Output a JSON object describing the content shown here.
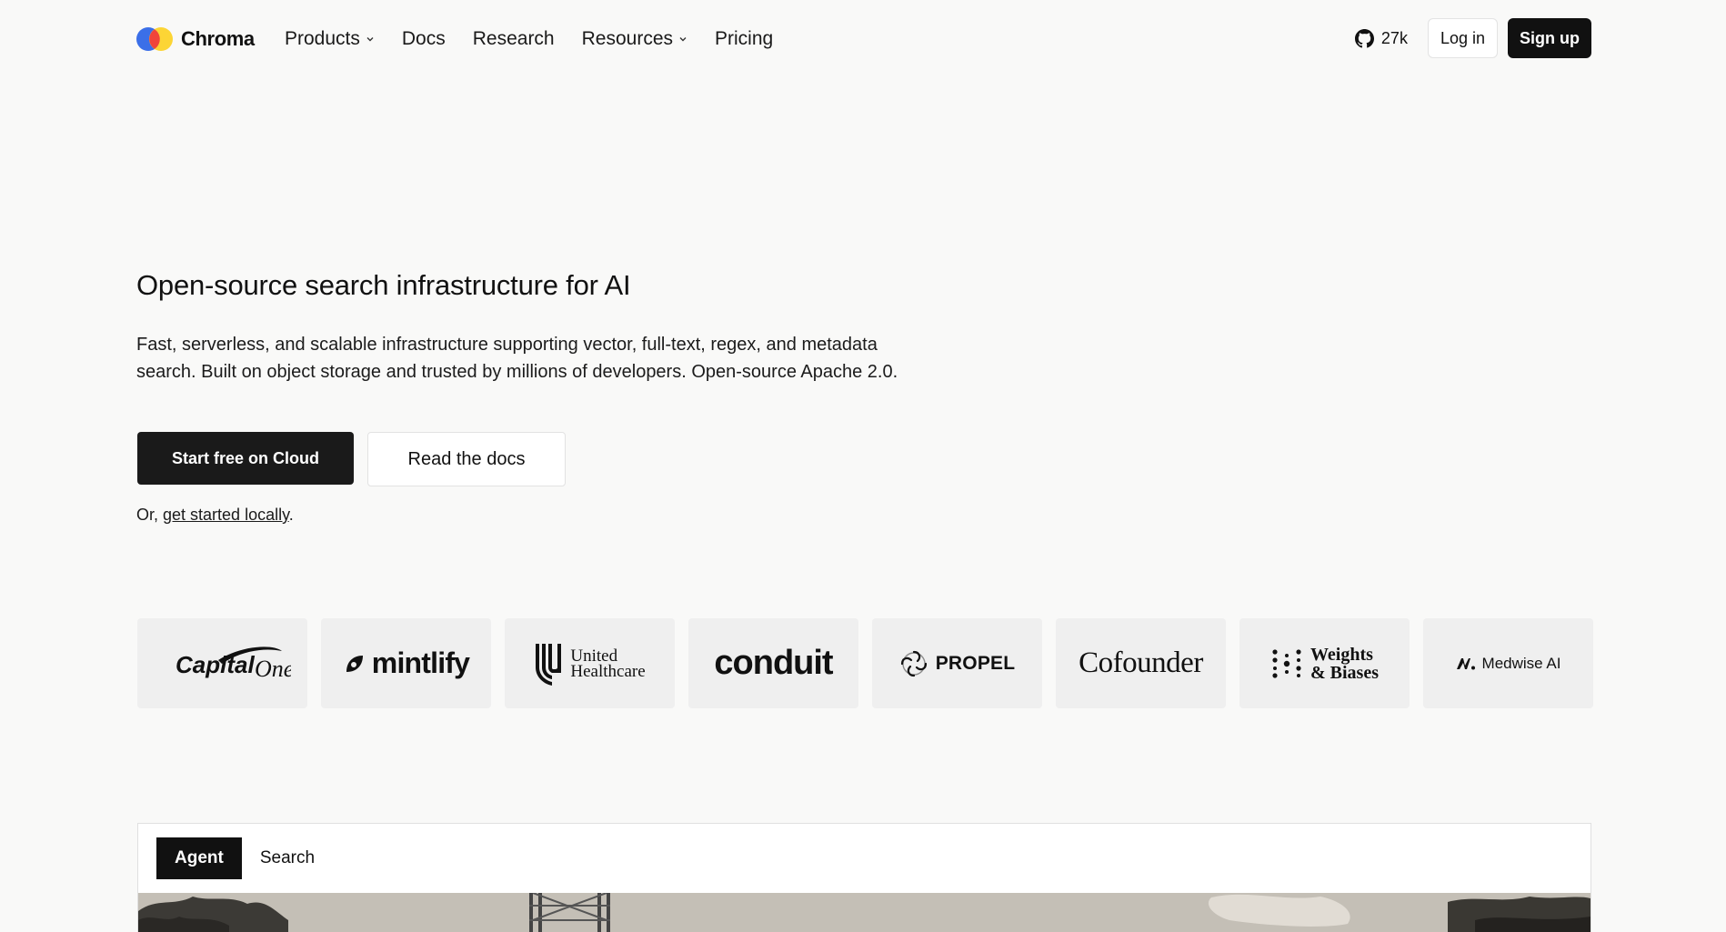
{
  "nav": {
    "brand": "Chroma",
    "links": [
      {
        "label": "Products",
        "dropdown": true
      },
      {
        "label": "Docs",
        "dropdown": false
      },
      {
        "label": "Research",
        "dropdown": false
      },
      {
        "label": "Resources",
        "dropdown": true
      },
      {
        "label": "Pricing",
        "dropdown": false
      }
    ],
    "github_stars": "27k",
    "login_label": "Log in",
    "signup_label": "Sign up"
  },
  "hero": {
    "title": "Open-source search infrastructure for AI",
    "subtitle_line1": "Fast, serverless, and scalable infrastructure supporting vector, full-text, regex, and metadata",
    "subtitle_line2": "search. Built on object storage and trusted by millions of developers. Open-source Apache 2.0.",
    "primary_cta": "Start free on Cloud",
    "secondary_cta": "Read the docs",
    "local_prefix": "Or, ",
    "local_link": "get started locally",
    "local_suffix": "."
  },
  "customers": [
    {
      "name": "Capital One",
      "text_a": "Capital",
      "text_b": "One"
    },
    {
      "name": "mintlify",
      "text": "mintlify"
    },
    {
      "name": "United Healthcare",
      "line1": "United",
      "line2": "Healthcare"
    },
    {
      "name": "conduit",
      "text": "conduit"
    },
    {
      "name": "PROPEL",
      "text": "PROPEL"
    },
    {
      "name": "Cofounder",
      "text": "Cofounder"
    },
    {
      "name": "Weights & Biases",
      "line1": "Weights",
      "line2": "& Biases"
    },
    {
      "name": "Medwise AI",
      "text": "Medwise AI"
    }
  ],
  "demo": {
    "tabs": [
      {
        "label": "Agent",
        "active": true
      },
      {
        "label": "Search",
        "active": false
      }
    ]
  },
  "colors": {
    "background": "#f9f9f8",
    "primary": "#111111",
    "logo_blue": "#3b6fe8",
    "logo_red": "#f0453a",
    "logo_yellow": "#fcd535"
  }
}
